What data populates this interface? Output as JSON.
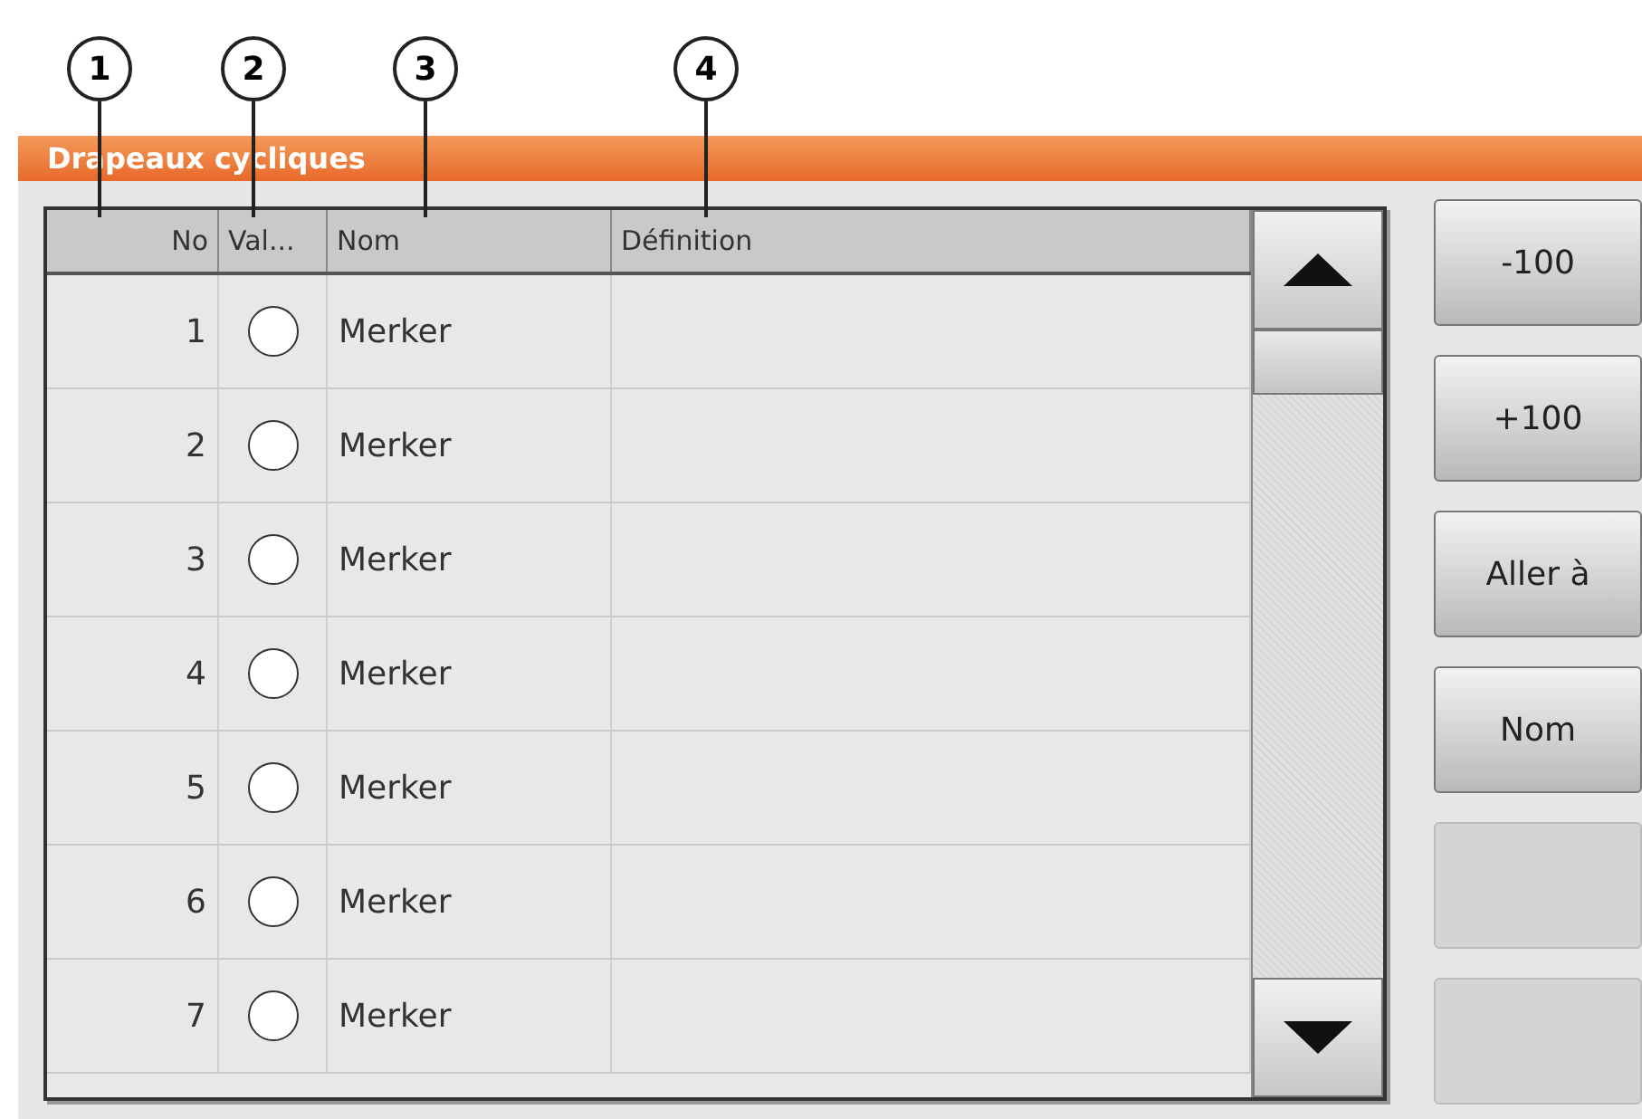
{
  "callouts": [
    "1",
    "2",
    "3",
    "4"
  ],
  "window": {
    "title": "Drapeaux cycliques"
  },
  "table": {
    "columns": [
      "No",
      "Val...",
      "Nom",
      "Définition"
    ],
    "rows": [
      {
        "no": "1",
        "on": false,
        "name": "Merker"
      },
      {
        "no": "2",
        "on": false,
        "name": "Merker"
      },
      {
        "no": "3",
        "on": false,
        "name": "Merker"
      },
      {
        "no": "4",
        "on": false,
        "name": "Merker"
      },
      {
        "no": "5",
        "on": false,
        "name": "Merker"
      },
      {
        "no": "6",
        "on": false,
        "name": "Merker"
      },
      {
        "no": "7",
        "on": false,
        "name": "Merker"
      }
    ]
  },
  "buttons": [
    {
      "label": "-100",
      "disabled": false
    },
    {
      "label": "+100",
      "disabled": false
    },
    {
      "label": "Aller à",
      "disabled": false
    },
    {
      "label": "Nom",
      "disabled": false
    },
    {
      "disabled": true
    },
    {
      "disabled": true
    }
  ]
}
